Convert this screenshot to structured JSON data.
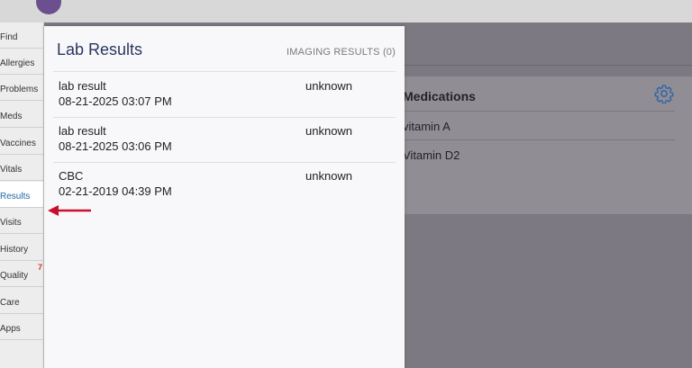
{
  "sidebar": {
    "items": [
      {
        "label": "Find",
        "badge": ""
      },
      {
        "label": "Allergies",
        "badge": ""
      },
      {
        "label": "Problems",
        "badge": ""
      },
      {
        "label": "Meds",
        "badge": ""
      },
      {
        "label": "Vaccines",
        "badge": ""
      },
      {
        "label": "Vitals",
        "badge": ""
      },
      {
        "label": "Results",
        "badge": ""
      },
      {
        "label": "Visits",
        "badge": ""
      },
      {
        "label": "History",
        "badge": ""
      },
      {
        "label": "Quality",
        "badge": "7"
      },
      {
        "label": "Care",
        "badge": ""
      },
      {
        "label": "Apps",
        "badge": ""
      }
    ],
    "active": "Results"
  },
  "background": {
    "medications_title": "Medications",
    "medications": [
      "vitamin A",
      "Vitamin D2"
    ]
  },
  "panel": {
    "title": "Lab Results",
    "imaging_tab": "IMAGING RESULTS (0)",
    "results": [
      {
        "name": "lab result",
        "date": "08-21-2025 03:07 PM",
        "status": "unknown"
      },
      {
        "name": "lab result",
        "date": "08-21-2025 03:06 PM",
        "status": "unknown"
      },
      {
        "name": "CBC",
        "date": "02-21-2019 04:39 PM",
        "status": "unknown"
      }
    ]
  },
  "colors": {
    "arrow": "#c8102e",
    "active_nav_text": "#1f6aa8",
    "panel_title": "#2a3560",
    "badge": "#d0372f"
  }
}
